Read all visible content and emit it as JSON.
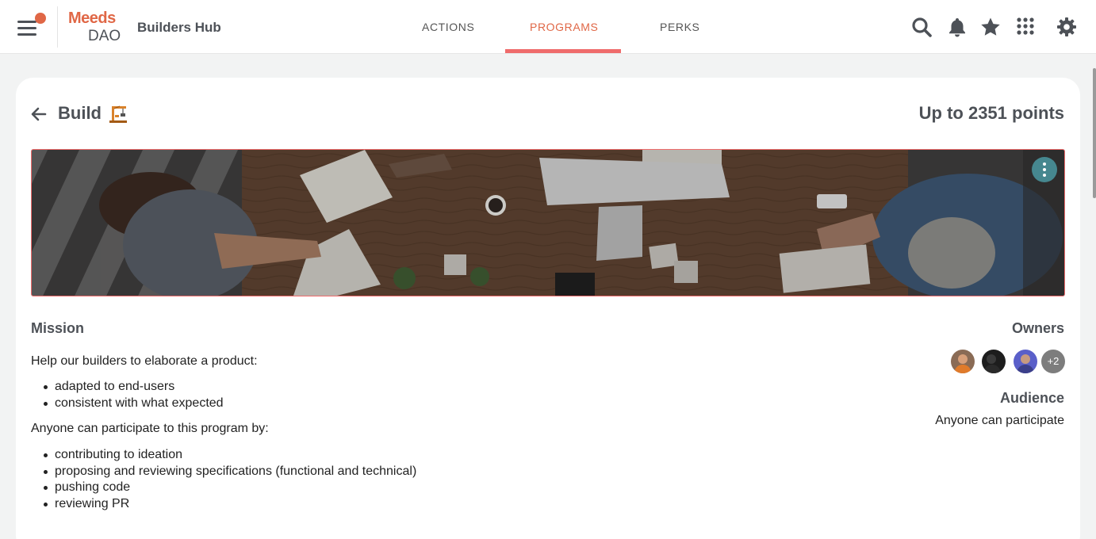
{
  "header": {
    "logo_top": "Meeds",
    "logo_bottom": "DAO",
    "hub_title": "Builders Hub",
    "tabs": [
      {
        "label": "ACTIONS",
        "active": false
      },
      {
        "label": "PROGRAMS",
        "active": true
      },
      {
        "label": "PERKS",
        "active": false
      }
    ],
    "icons": [
      "search-icon",
      "bell-icon",
      "star-icon",
      "apps-grid-icon",
      "gear-icon"
    ],
    "accent_color": "#e06746"
  },
  "program": {
    "title": "Build",
    "title_icon": "crane-icon",
    "points": "Up to 2351 points",
    "mission_heading": "Mission",
    "intro": "Help our builders to elaborate a product:",
    "goals": [
      "adapted to end-users",
      "consistent with what expected"
    ],
    "participate_intro": "Anyone can participate to this program by:",
    "ways": [
      "contributing to ideation",
      "proposing and reviewing specifications (functional and technical)",
      "pushing code",
      "reviewing PR"
    ],
    "owners_heading": "Owners",
    "owners_more": "+2",
    "audience_heading": "Audience",
    "audience_value": "Anyone can participate"
  }
}
